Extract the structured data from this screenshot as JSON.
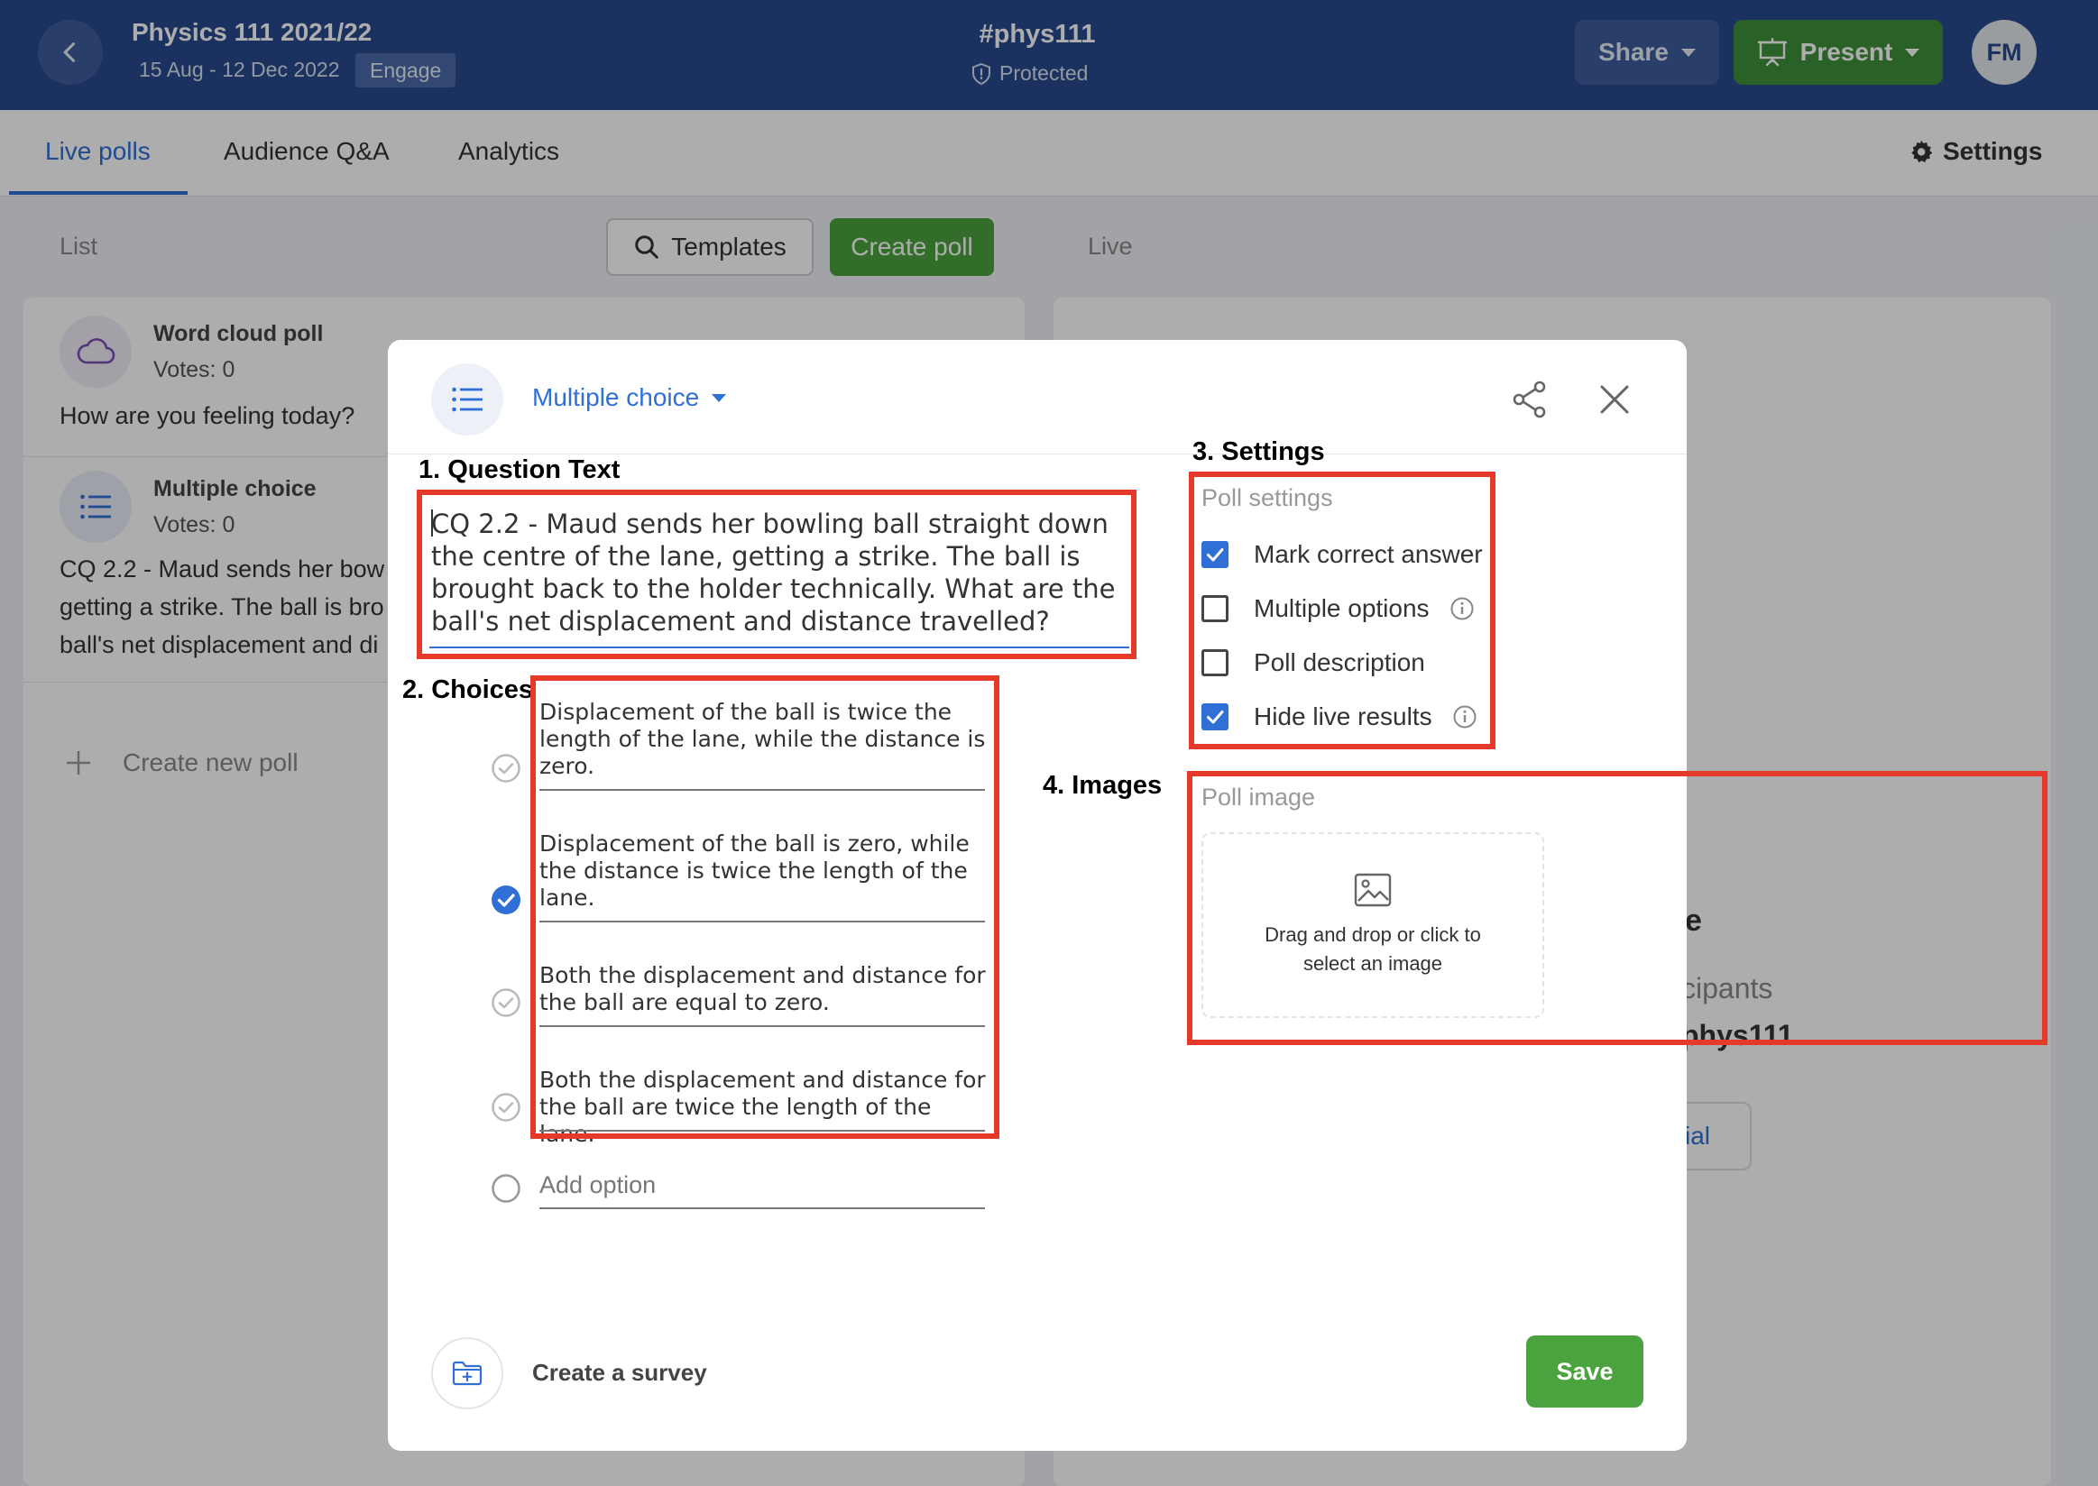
{
  "header": {
    "course_title": "Physics 111 2021/22",
    "course_dates": "15 Aug - 12 Dec 2022",
    "badge": "Engage",
    "channel": "#phys111",
    "protected": "Protected",
    "share_label": "Share",
    "present_label": "Present",
    "avatar_initials": "FM"
  },
  "tabs": [
    {
      "label": "Live polls",
      "active": true
    },
    {
      "label": "Audience Q&A",
      "active": false
    },
    {
      "label": "Analytics",
      "active": false
    }
  ],
  "settings_label": "Settings",
  "list_panel": {
    "label": "List",
    "templates_label": "Templates",
    "create_poll_label": "Create poll",
    "polls": [
      {
        "type": "Word cloud poll",
        "votes": "Votes: 0",
        "question": "How are you feeling today?"
      },
      {
        "type": "Multiple choice",
        "votes": "Votes: 0",
        "question_lines": [
          "CQ 2.2 - Maud sends her bow",
          "getting a strike. The ball is bro",
          "ball's net displacement and di"
        ]
      }
    ],
    "create_new_label": "Create new poll"
  },
  "live_panel": {
    "label": "Live",
    "visible_fragments": [
      "e",
      "cipants",
      "phys111",
      "rial"
    ]
  },
  "modal": {
    "poll_type": "Multiple choice",
    "annotations": {
      "question": "1. Question Text",
      "choices": "2. Choices",
      "settings": "3. Settings",
      "images": "4. Images"
    },
    "question_lines": [
      "CQ 2.2 - Maud sends her bowling ball straight down",
      "the centre of the lane, getting a strike. The ball is",
      "brought back to the holder technically. What are the",
      "ball's net displacement and distance travelled?"
    ],
    "choices": [
      {
        "lines": [
          "Displacement of the ball is twice the",
          "length of the lane, while the distance is",
          "zero."
        ],
        "correct": false
      },
      {
        "lines": [
          "Displacement of the ball is zero, while",
          "the distance is twice the length of the",
          "lane."
        ],
        "correct": true
      },
      {
        "lines": [
          "Both the displacement and distance for",
          "the ball are equal to zero."
        ],
        "correct": false
      },
      {
        "lines": [
          "Both the displacement and distance for",
          "the ball are twice the length of the lane."
        ],
        "correct": false
      }
    ],
    "add_option_placeholder": "Add option",
    "poll_settings": {
      "heading": "Poll settings",
      "items": [
        {
          "label": "Mark correct answer",
          "checked": true,
          "info": false
        },
        {
          "label": "Multiple options",
          "checked": false,
          "info": true
        },
        {
          "label": "Poll description",
          "checked": false,
          "info": false
        },
        {
          "label": "Hide live results",
          "checked": true,
          "info": true
        }
      ]
    },
    "poll_image": {
      "heading": "Poll image",
      "dropzone_lines": [
        "Drag and drop or click to",
        "select an image"
      ]
    },
    "create_survey_label": "Create a survey",
    "save_label": "Save"
  },
  "colors": {
    "navy": "#284b8f",
    "accent_blue": "#2f6fd6",
    "green": "#4aa33e",
    "annotation_red": "#e53a2a"
  }
}
